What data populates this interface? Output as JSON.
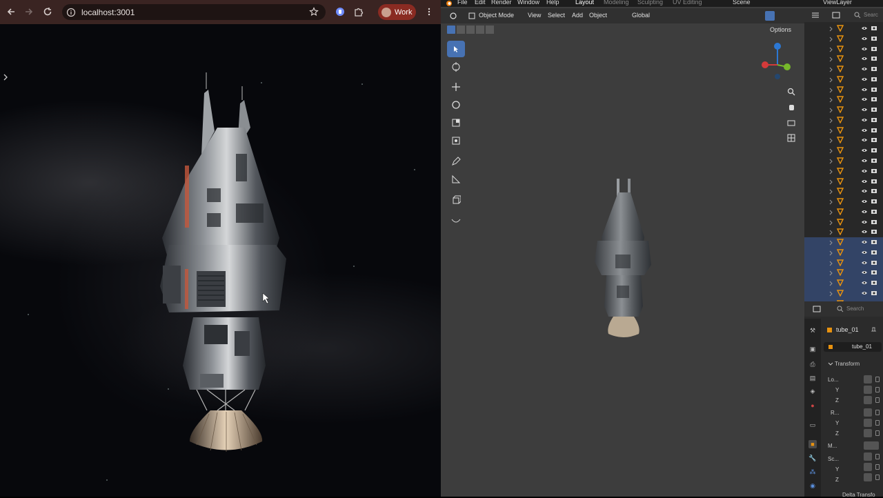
{
  "browser": {
    "url": "localhost:3001",
    "profile_label": "Work"
  },
  "blender": {
    "menu": [
      "File",
      "Edit",
      "Render",
      "Window",
      "Help"
    ],
    "workspace_tabs": [
      "Layout",
      "Modeling",
      "Sculpting",
      "UV Editing"
    ],
    "scene_label": "Scene",
    "view_layer_label": "ViewLayer",
    "header": {
      "mode": "Object Mode",
      "view": "View",
      "select": "Select",
      "add": "Add",
      "object": "Object",
      "orientation": "Global",
      "options": "Options"
    },
    "outliner": {
      "search_placeholder": "Searc"
    },
    "properties": {
      "search_placeholder": "Search",
      "object_name": "tube_01",
      "data_name": "tube_01",
      "panel_transform": "Transform",
      "loc_label": "Lo...",
      "rot_label": "R...",
      "mode_label": "M...",
      "scale_label": "Sc...",
      "y_label": "Y",
      "z_label": "Z",
      "delta_label": "Delta Transfo"
    }
  }
}
